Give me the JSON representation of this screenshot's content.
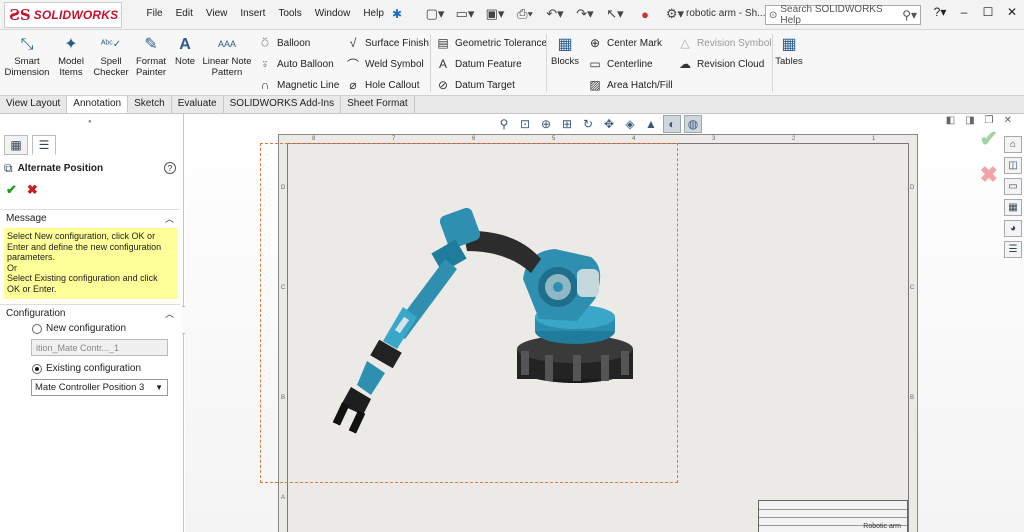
{
  "app": {
    "brand": "SOLIDWORKS",
    "document_title": "robotic arm - Sh..."
  },
  "menu": [
    "File",
    "Edit",
    "View",
    "Insert",
    "Tools",
    "Window",
    "Help"
  ],
  "search": {
    "placeholder": "Search SOLIDWORKS Help"
  },
  "ribbon": {
    "smart_dimension": "Smart Dimension",
    "model_items": "Model Items",
    "spell_checker": "Spell Checker",
    "format_painter": "Format Painter",
    "note": "Note",
    "linear_note_pattern": "Linear Note Pattern",
    "balloon": "Balloon",
    "auto_balloon": "Auto Balloon",
    "magnetic_line": "Magnetic Line",
    "surface_finish": "Surface Finish",
    "weld_symbol": "Weld Symbol",
    "hole_callout": "Hole Callout",
    "geometric_tolerance": "Geometric Tolerance",
    "datum_feature": "Datum Feature",
    "datum_target": "Datum Target",
    "blocks": "Blocks",
    "center_mark": "Center Mark",
    "centerline": "Centerline",
    "area_hatch": "Area Hatch/Fill",
    "revision_symbol": "Revision Symbol",
    "revision_cloud": "Revision Cloud",
    "tables": "Tables"
  },
  "tabs": [
    "View Layout",
    "Annotation",
    "Sketch",
    "Evaluate",
    "SOLIDWORKS Add-Ins",
    "Sheet Format"
  ],
  "active_tab": "Annotation",
  "property_manager": {
    "title": "Alternate Position",
    "message_header": "Message",
    "message_lines": [
      "Select New configuration, click OK or",
      "Enter and define the new configuration",
      "parameters.",
      "Or",
      "Select Existing configuration and click",
      "OK or Enter."
    ],
    "configuration_header": "Configuration",
    "new_configuration_label": "New configuration",
    "new_configuration_value": "ition_Mate Contr..._1",
    "existing_configuration_label": "Existing configuration",
    "existing_configuration_value": "Mate Controller Position 3",
    "selected_option": "existing"
  },
  "sheet": {
    "zone_numbers": [
      "8",
      "7",
      "6",
      "5",
      "4",
      "3",
      "2",
      "1"
    ],
    "zone_letters": [
      "D",
      "C",
      "B",
      "A"
    ],
    "title_block_text": "Robotic arm"
  },
  "colors": {
    "accent_red": "#c8102e",
    "robot_teal": "#2e8fb0",
    "selection_dash": "#e07a3c",
    "message_bg": "#ffff99"
  }
}
